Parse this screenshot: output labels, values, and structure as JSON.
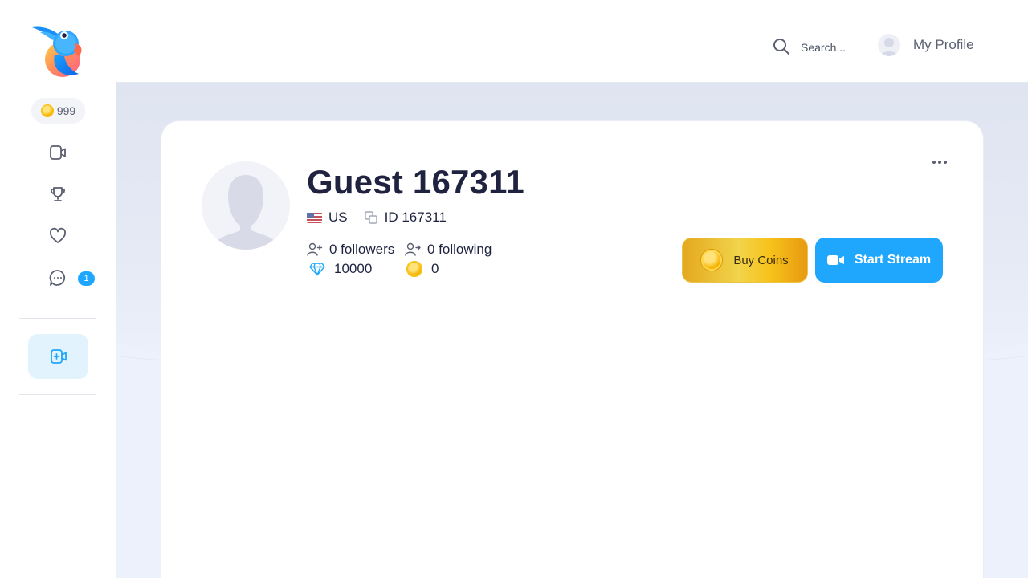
{
  "sidebar": {
    "coins": "999",
    "nav": [
      {
        "name": "live-icon"
      },
      {
        "name": "trophy-icon"
      },
      {
        "name": "heart-icon"
      },
      {
        "name": "chat-icon"
      }
    ],
    "messages_badge": "1",
    "create_icon": "video-plus-icon"
  },
  "header": {
    "search_placeholder": "Search...",
    "profile_label": "My Profile"
  },
  "profile": {
    "username": "Guest 167311",
    "country": "US",
    "id_text": "ID 167311",
    "followers": "0 followers",
    "following": "0 following",
    "diamonds": "10000",
    "coins": "0"
  },
  "actions": {
    "buy_coins": "Buy Coins",
    "start_stream": "Start Stream"
  },
  "colors": {
    "accent": "#1ea7fd",
    "gold": "#f6b400",
    "text": "#1f2340"
  }
}
